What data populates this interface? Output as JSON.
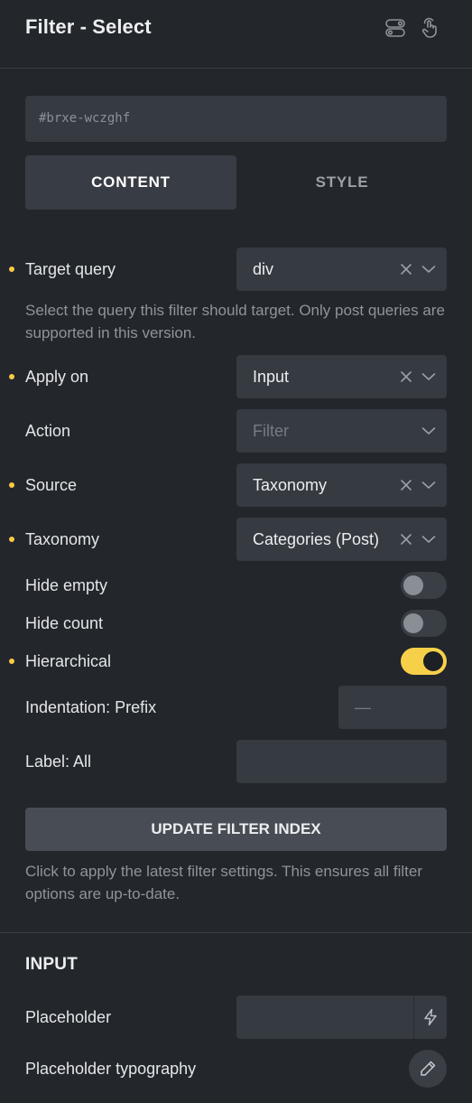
{
  "header": {
    "title": "Filter - Select",
    "icons": [
      "toggle-switches-icon",
      "pointer-hand-icon"
    ]
  },
  "element_id": "#brxe-wczghf",
  "tabs": [
    {
      "label": "CONTENT",
      "active": true
    },
    {
      "label": "STYLE",
      "active": false
    }
  ],
  "controls": {
    "target_query": {
      "label": "Target query",
      "value": "div",
      "description": "Select the query this filter should target. Only post queries are supported in this version."
    },
    "apply_on": {
      "label": "Apply on",
      "value": "Input"
    },
    "action": {
      "label": "Action",
      "placeholder": "Filter"
    },
    "source": {
      "label": "Source",
      "value": "Taxonomy"
    },
    "taxonomy": {
      "label": "Taxonomy",
      "value": "Categories (Post)"
    },
    "hide_empty": {
      "label": "Hide empty",
      "on": false
    },
    "hide_count": {
      "label": "Hide count",
      "on": false
    },
    "hierarchical": {
      "label": "Hierarchical",
      "on": true
    },
    "indentation_prefix": {
      "label": "Indentation: Prefix",
      "placeholder": "—"
    },
    "label_all": {
      "label": "Label: All",
      "value": ""
    }
  },
  "update_button": {
    "label": "UPDATE FILTER INDEX",
    "description": "Click to apply the latest filter settings. This ensures all filter options are up-to-date."
  },
  "input_section": {
    "title": "INPUT",
    "placeholder": {
      "label": "Placeholder",
      "value": ""
    },
    "placeholder_typography": {
      "label": "Placeholder typography"
    }
  },
  "colors": {
    "background": "#23262b",
    "field": "#363a41",
    "accent": "#f7cb45",
    "text": "#e6e8ea",
    "muted": "#8f949b"
  }
}
